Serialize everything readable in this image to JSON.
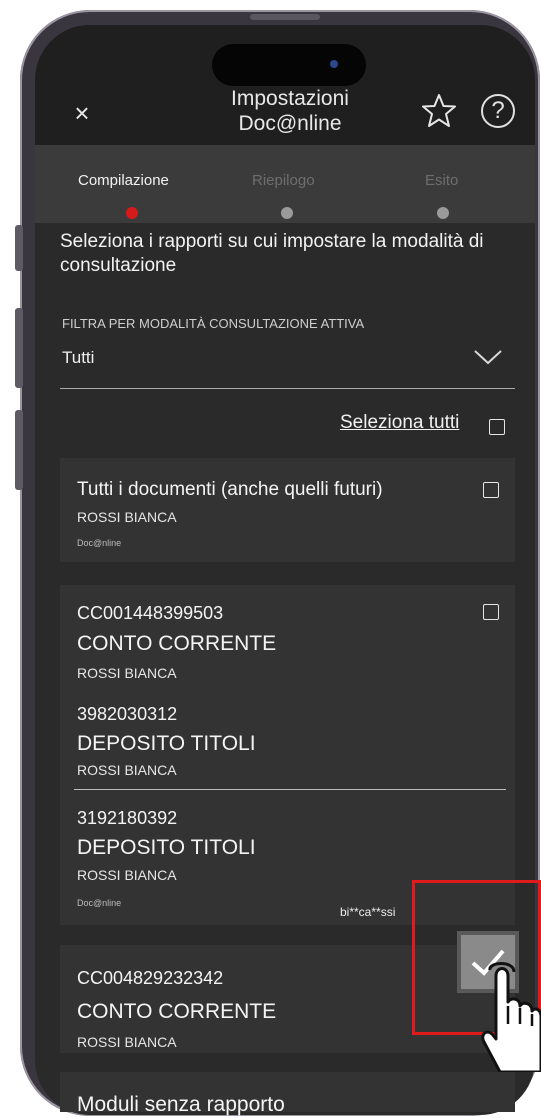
{
  "header": {
    "title_line1": "Impostazioni",
    "title_line2": "Doc@nline",
    "close_glyph": "×",
    "help_glyph": "?"
  },
  "stepper": {
    "steps": [
      {
        "label": "Compilazione",
        "active": true
      },
      {
        "label": "Riepilogo",
        "active": false
      },
      {
        "label": "Esito",
        "active": false
      }
    ],
    "active_color": "#d61a1a"
  },
  "intro": "Seleziona i rapporti su cui impostare la modalità di consultazione",
  "filter": {
    "label": "FILTRA PER MODALITÀ CONSULTAZIONE ATTIVA",
    "value": "Tutti"
  },
  "select_all": "Seleziona tutti",
  "card_all": {
    "title": "Tutti i documenti (anche quelli futuri)",
    "owner": "ROSSI BIANCA",
    "tag": "Doc@nline"
  },
  "group": {
    "items": [
      {
        "number": "CC001448399503",
        "type": "CONTO CORRENTE",
        "owner": "ROSSI BIANCA"
      },
      {
        "number": "3982030312",
        "type": "DEPOSITO TITOLI",
        "owner": "ROSSI BIANCA"
      },
      {
        "number": "3192180392",
        "type": "DEPOSITO TITOLI",
        "owner": "ROSSI BIANCA"
      }
    ],
    "tag": "Doc@nline",
    "masked_email": "bi**ca**ssi"
  },
  "card_cc2": {
    "number": "CC004829232342",
    "type": "CONTO CORRENTE",
    "owner": "ROSSI BIANCA"
  },
  "bottom_partial": "Moduli senza rapporto",
  "colors": {
    "screen_bg": "#2a2a2a",
    "card_bg": "#333333",
    "highlight": "#e01b1b"
  }
}
